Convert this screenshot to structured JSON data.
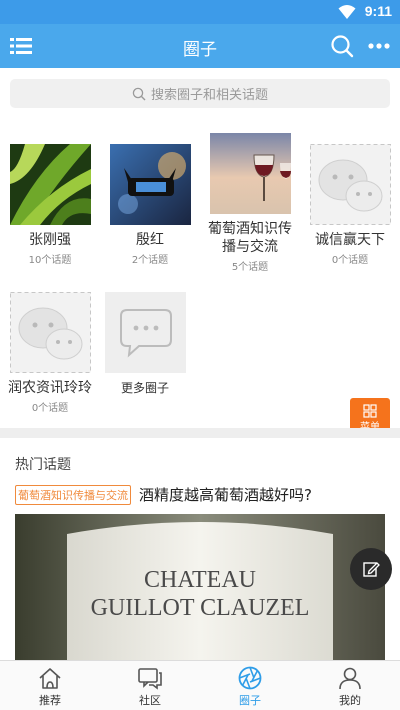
{
  "status": {
    "time": "9:11"
  },
  "header": {
    "title": "圈子"
  },
  "search": {
    "placeholder": "搜索圈子和相关话题"
  },
  "circles": [
    {
      "name": "张刚强",
      "count": "10个话题"
    },
    {
      "name": "殷红",
      "count": "2个话题"
    },
    {
      "name": "葡萄酒知识传播与交流",
      "count": "5个话题"
    },
    {
      "name": "诚信赢天下",
      "count": "0个话题"
    },
    {
      "name": "润农资讯玲玲",
      "count": "0个话题"
    }
  ],
  "more_circles": {
    "label": "更多圈子"
  },
  "menu_button": {
    "label": "菜单"
  },
  "hot_topics": {
    "heading": "热门话题",
    "tag": "葡萄酒知识传播与交流",
    "title": "酒精度越高葡萄酒越好吗?",
    "image_text": [
      "CHATEAU",
      "GUILLOT CLAUZEL"
    ]
  },
  "tabs": [
    {
      "label": "推荐",
      "icon": "home-icon",
      "active": false
    },
    {
      "label": "社区",
      "icon": "chat-bubbles-icon",
      "active": false
    },
    {
      "label": "圈子",
      "icon": "aperture-icon",
      "active": true
    },
    {
      "label": "我的",
      "icon": "person-icon",
      "active": false
    }
  ],
  "colors": {
    "accent": "#4aa8ec",
    "status_bar": "#3d9be9",
    "menu_button": "#f5731c",
    "tag": "#f08a3c",
    "active_tab": "#2f9de8"
  }
}
